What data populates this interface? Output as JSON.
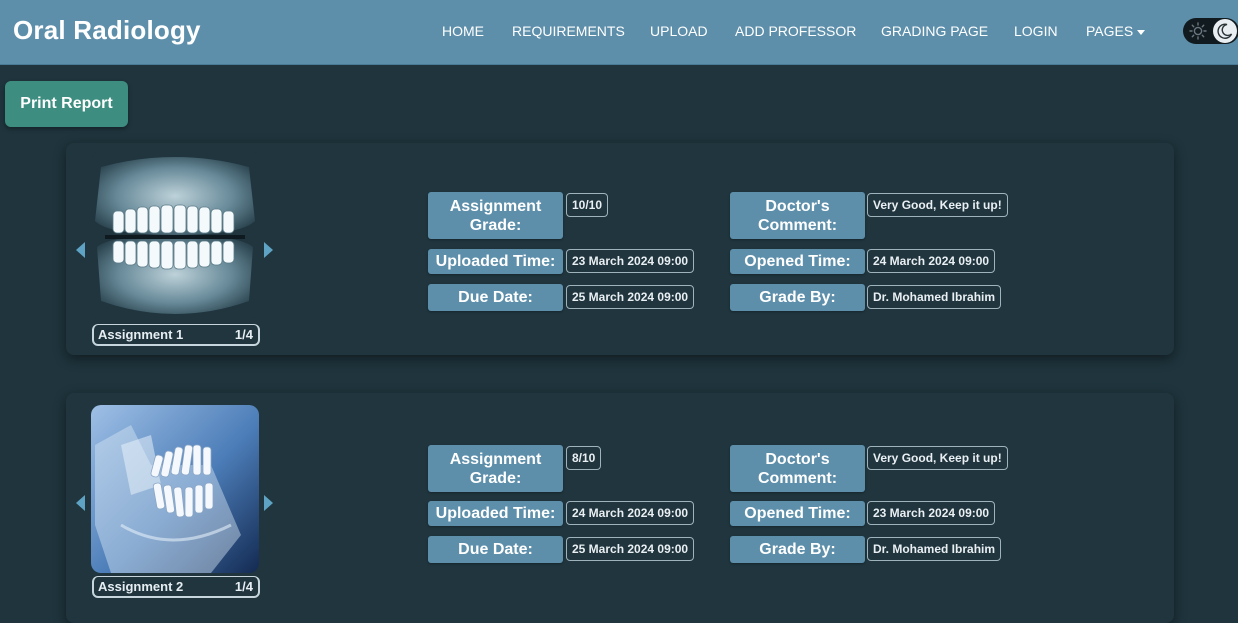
{
  "app": {
    "title": "Oral Radiology"
  },
  "nav": {
    "items": [
      "HOME",
      "REQUIREMENTS",
      "UPLOAD",
      "ADD PROFESSOR",
      "GRADING PAGE",
      "LOGIN",
      "PAGES"
    ]
  },
  "toolbar": {
    "print_label": "Print Report"
  },
  "labels": {
    "assignment_grade": "Assignment Grade:",
    "uploaded_time": "Uploaded Time:",
    "due_date": "Due Date:",
    "doctor_comment": "Doctor's Comment:",
    "opened_time": "Opened Time:",
    "grade_by": "Grade By:"
  },
  "assignments": [
    {
      "caption": "Assignment 1",
      "image_counter": "1/4",
      "grade": "10/10",
      "uploaded_time": "23 March 2024 09:00",
      "due_date": "25 March 2024 09:00",
      "comment": "Very Good, Keep it up!",
      "opened_time": "24 March 2024 09:00",
      "grade_by": "Dr. Mohamed Ibrahim"
    },
    {
      "caption": "Assignment 2",
      "image_counter": "1/4",
      "grade": "8/10",
      "uploaded_time": "24 March 2024 09:00",
      "due_date": "25 March 2024 09:00",
      "comment": "Very Good, Keep it up!",
      "opened_time": "23 March 2024 09:00",
      "grade_by": "Dr. Mohamed Ibrahim"
    }
  ],
  "colors": {
    "navbar": "#5d8fab",
    "background": "#1f343d",
    "print_button": "#3d8e80",
    "label_box": "#5d8fab"
  },
  "icons": [
    "sun-icon",
    "moon-icon",
    "chevron-left-icon",
    "chevron-right-icon",
    "caret-down-icon"
  ]
}
